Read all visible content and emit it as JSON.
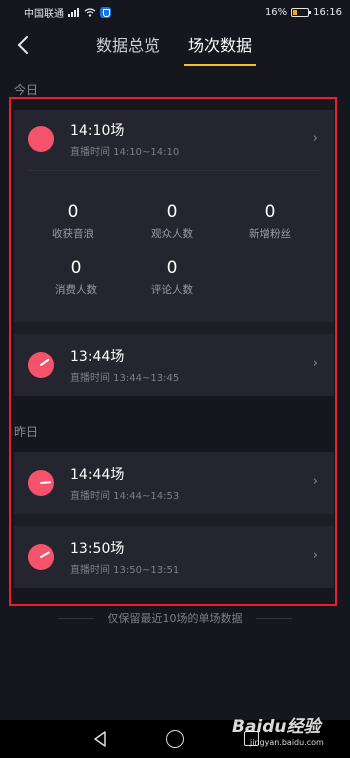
{
  "status_bar": {
    "carrier": "中国联通",
    "battery": "16%",
    "time": "16:16"
  },
  "header": {
    "tabs": [
      {
        "label": "数据总览",
        "active": false
      },
      {
        "label": "场次数据",
        "active": true
      }
    ],
    "accent_color": "#f7c02b"
  },
  "today": {
    "label": "今日",
    "expanded_session": {
      "title": "14:10场",
      "time": "直播时间 14:10~14:10",
      "stats": [
        {
          "value": "0",
          "label": "收获音浪"
        },
        {
          "value": "0",
          "label": "观众人数"
        },
        {
          "value": "0",
          "label": "新增粉丝"
        },
        {
          "value": "0",
          "label": "消费人数"
        },
        {
          "value": "0",
          "label": "评论人数"
        }
      ]
    },
    "sessions": [
      {
        "title": "13:44场",
        "time": "直播时间 13:44~13:45"
      }
    ]
  },
  "yesterday": {
    "label": "昨日",
    "sessions": [
      {
        "title": "14:44场",
        "time": "直播时间 14:44~14:53"
      },
      {
        "title": "13:50场",
        "time": "直播时间 13:50~13:51"
      }
    ]
  },
  "footer_note": "仅保留最近10场的单场数据",
  "watermark": {
    "main": "Baidu经验",
    "sub": "jingyan.baidu.com"
  },
  "colors": {
    "background": "#16161e",
    "card": "#252530",
    "avatar": "#f5536b",
    "highlight_frame": "#e8202a"
  }
}
